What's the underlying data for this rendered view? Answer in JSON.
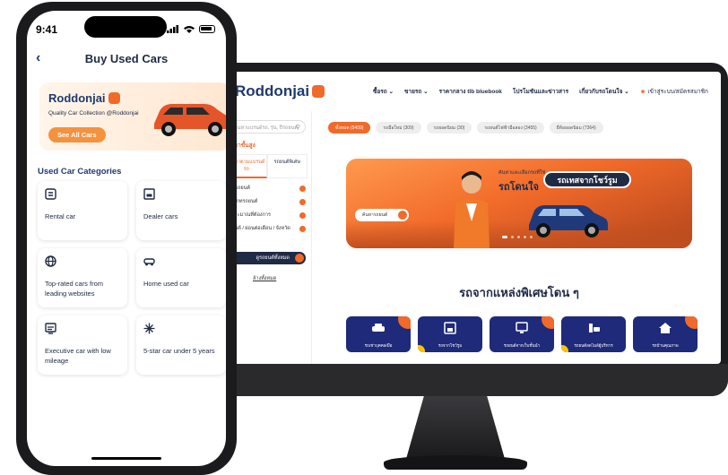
{
  "desktop": {
    "brand": "Roddonjai",
    "nav": [
      "ซื้อรถ ⌄",
      "ขายรถ ⌄",
      "ราคากลาง tlb bluebook",
      "โปรโมชันและข่าวสาร",
      "เกี่ยวกับรถโดนใจ ⌄"
    ],
    "login_label": "เข้าสู่ระบบ/สมัครสมาชิก",
    "search_placeholder": "ค้นหาแบรนด์รถ, รุ่น, ปีรถยนต์",
    "sidebar_title": "ค้นหาขั้นสูง",
    "sidebar_tabs": [
      "ค้นหาตามแบรนด์รถ",
      "รถยนต์พิเศษ"
    ],
    "filters": [
      "ยี่ห้อรถยนต์",
      "ประเภทรถยนต์",
      "งบประมาณที่ต้องการ",
      "รถยนต์ / ผ่อนต่อเดือน / จังหวัด"
    ],
    "sidebar_button": "ดูรถยนต์ทั้งหมด",
    "sidebar_link": "ล้างทั้งหมด",
    "chips": [
      "ทั้งหมด (5409)",
      "รถมือใหม่ (309)",
      "รถยอดนิยม (30)",
      "รถยนต์ไฟฟ้ามือสอง (3455)",
      "ยี่ห้อยอดนิยม (7364)"
    ],
    "hero": {
      "small_text": "ค้นหาและเลือกรถที่ใช่",
      "big_text": "รถโดนใจ",
      "pill_text": "รถเทสจากโชว์รูม",
      "button_text": "ค้นหารถยนต์"
    },
    "section_title": "รถจากแหล่งพิเศษโดน ๆ",
    "cards": [
      "รถเช่าบุคคล/มือ",
      "รถจากโชว์รูม",
      "รถยนต์จากเว็บชั้นนำ",
      "รถยนต์ลดไมล์ผู้บริหาร",
      "รถบ้านคุณภาพ"
    ]
  },
  "phone": {
    "time": "9:41",
    "title": "Buy Used Cars",
    "banner": {
      "brand": "Roddonjai",
      "tagline": "Quality Car Collection @Roddonjai",
      "cta": "See All Cars"
    },
    "categories_title": "Used Car Categories",
    "categories": [
      {
        "icon": "car-rental-icon",
        "label": "Rental car"
      },
      {
        "icon": "dealer-store-icon",
        "label": "Dealer cars"
      },
      {
        "icon": "globe-icon",
        "label": "Top-rated cars from leading websites"
      },
      {
        "icon": "home-car-icon",
        "label": "Home used car"
      },
      {
        "icon": "executive-car-icon",
        "label": "Executive car with low mileage"
      },
      {
        "icon": "sparkle-icon",
        "label": "5-star car under 5 years"
      }
    ]
  },
  "colors": {
    "brand_navy": "#1f3a6e",
    "brand_orange": "#f06a2a",
    "cta_orange": "#f5923e",
    "card_navy": "#1f2a7a"
  }
}
